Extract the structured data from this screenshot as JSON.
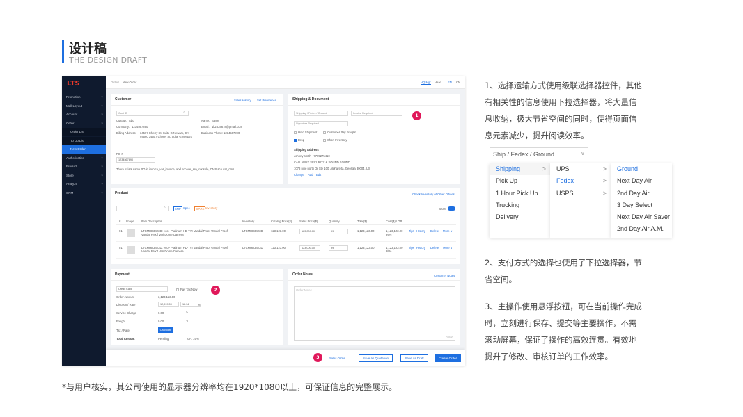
{
  "header": {
    "title": "设计稿",
    "subtitle": "THE DESIGN DRAFT"
  },
  "app": {
    "logo": "LTS",
    "nav": [
      {
        "label": "Promotion"
      },
      {
        "label": "Mall Layout"
      },
      {
        "label": "Account"
      },
      {
        "label": "Order"
      },
      {
        "label": "Order List",
        "sub": true
      },
      {
        "label": "To Do List",
        "sub": true
      },
      {
        "label": "New Order",
        "sub": true,
        "active": true
      },
      {
        "label": "Authorization"
      },
      {
        "label": "Product"
      },
      {
        "label": "Store"
      },
      {
        "label": "Analyze"
      },
      {
        "label": "CRM"
      }
    ],
    "breadcrumb": {
      "parent": "Order",
      "current": "New Order"
    },
    "topbar": {
      "org": "HQ Mgr",
      "user": "Head",
      "lang_en": "EN",
      "lang_cn": "CN"
    },
    "customer": {
      "title": "Customer",
      "link1": "Sales History",
      "link2": "Set Preference",
      "cust_id_placeholder": "Cust ID",
      "custid_label": "Cust ID:",
      "custid_val": "Abc",
      "company_label": "Company:",
      "company_val": "1234567890",
      "billing_label": "Billing Address:",
      "billing_val1": "34507 Cherry St. Suite G Newark, CA",
      "billing_val2": "94560 34507 Cherry St. Suite G Newark",
      "name_label": "Name:",
      "name_val": "name",
      "email_label": "Email:",
      "email_val": "1k2534678@gmail.com",
      "phone_label": "Business Phone:",
      "phone_val": "1234567890",
      "po_label": "PO #",
      "po_val": "1234567890",
      "note": "There exists same PO in invoice_var_invoice, and sco var_sro_console, OMS sco var_oms."
    },
    "shipping": {
      "title": "Shipping & Document",
      "ship_select": "Shipping / Fedex / Ground",
      "invoice_select": "Invoice Required",
      "signature_select": "Signature Required",
      "hold": "Hold Shipment",
      "customer_pay": "Customer Pay Freight",
      "drop": "Drop",
      "short": "Short Inventory",
      "addr_title": "Shipping Address",
      "addr1": "Johnny smith · 7705275410",
      "addr2": "CALLAWAY SECURITY & SOUND SOUND",
      "addr3": "1078 nine north Dr Ste 100, Alpharetta, Georgia 30004, US",
      "change": "Change",
      "add": "Add",
      "edit": "Edit"
    },
    "product": {
      "title": "Product",
      "link": "Check Inventory of Other Offices",
      "tag_zmp": "ZMP",
      "spec": "Spec",
      "tag_ware": "WARE",
      "inventory": "Inventory",
      "more": "More",
      "headers": [
        "#",
        "Image",
        "Item Description",
        "Inventory",
        "Catalog Price($)",
        "Sales Price($)",
        "Quantity",
        "Total($)",
        "Cost($) / GP"
      ],
      "rows": [
        {
          "no": "01",
          "desc1": "LTCMHD3423D: eco - Platinum HD-TVI Vandal Proof Vandal Proof",
          "desc2": "Vandal Proof Vari Dome Camera",
          "inv": "LTCMHD3423D",
          "cat": "123,123.00",
          "sale": "123,000.00",
          "qty": "99",
          "total": "1,123,123.00",
          "cost": "1,123,123.00",
          "gp": "99%"
        },
        {
          "no": "01",
          "desc1": "LTCMHD3423D: eco - Platinum HD-TVI Vandal Proof Vandal Proof",
          "desc2": "Vandal Proof Vari Dome Camera",
          "inv": "LTCMHD3423D",
          "cat": "123,123.00",
          "sale": "123,000.00",
          "qty": "99",
          "total": "1,123,123.00",
          "cost": "1,123,123.00",
          "gp": "99%"
        }
      ],
      "actions": {
        "tips": "Tips",
        "history": "History",
        "delete": "Delete",
        "more": "More ∨"
      }
    },
    "payment": {
      "title": "Payment",
      "method": "Credit Card",
      "paytax": "Pay Tax Now",
      "order_amount_label": "Order Amount",
      "order_amount": "3,123,123.00",
      "discount_label": "Discount/ Rate",
      "discount": "12,999.00",
      "rate": "12.34",
      "pct": "%",
      "service_label": "Service Charge",
      "service": "0.00",
      "freight_label": "Freight",
      "freight": "0.00",
      "tax_label": "Tax / Rate",
      "calc": "Calculate",
      "total_label": "Total Amount",
      "total": "Pending",
      "gp": "GP: 20%"
    },
    "notes": {
      "title": "Order Notes",
      "link": "Customer Notes",
      "placeholder": "Order Notes",
      "count": "0/800"
    },
    "footer": {
      "sales_order": "Sales Order",
      "quotation": "Save as Quotation",
      "draft": "Save as Draft",
      "create": "Create Order"
    },
    "badges": [
      "1",
      "2",
      "3"
    ]
  },
  "descriptions": {
    "p1": [
      "1、选择运输方式使用级联选择器控件，其他",
      "有相关性的信息使用下拉选择器，将大量信",
      "息收纳，极大节省空间的同时，使得页面信",
      "息元素减少，提升阅读效率。"
    ],
    "p2": [
      "2、支付方式的选择也使用了下拉选择器，节",
      "省空间。"
    ],
    "p3": [
      "3、主操作使用悬浮按钮，可在当前操作完成",
      "时，立刻进行保存、提交等主要操作，不需",
      "滚动屏幕，保证了操作的高效连贯。有效地",
      "提升了修改、审核订单的工作效率。"
    ]
  },
  "cascader": {
    "value": "Ship / Fedex / Ground",
    "col1": [
      "Shipping",
      "Pick Up",
      "1 Hour Pick Up",
      "Trucking",
      "Delivery"
    ],
    "col2": [
      "UPS",
      "Fedex",
      "USPS"
    ],
    "col3": [
      "Ground",
      "Next Day Air",
      "2nd Day Air",
      "3 Day Select",
      "Next Day Air Saver",
      "2nd Day Air A.M."
    ]
  },
  "footnote": "*与用户核实，其公司使用的显示器分辨率均在1920*1080以上，可保证信息的完整展示。",
  "colors": {
    "accent": "#1e6fe0",
    "sidebar": "#0f1a2e",
    "badge": "#e0185a"
  }
}
